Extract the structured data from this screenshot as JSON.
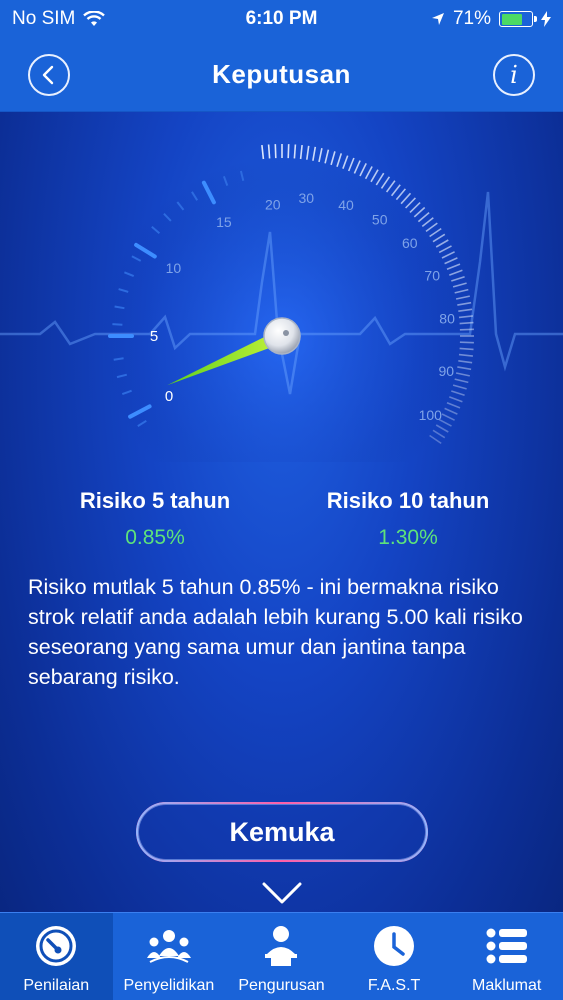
{
  "status_bar": {
    "carrier": "No SIM",
    "time": "6:10 PM",
    "battery": "71%",
    "battery_level": 0.71
  },
  "nav": {
    "title": "Keputusan",
    "back_icon": "chevron-left-icon",
    "info_icon": "info-icon",
    "info_glyph": "i"
  },
  "gauge": {
    "labels": [
      "0",
      "5",
      "10",
      "15",
      "20",
      "30",
      "40",
      "50",
      "60",
      "70",
      "80",
      "90",
      "100"
    ],
    "needle_value": 0.85
  },
  "risk": {
    "five": {
      "label": "Risiko 5 tahun",
      "value": "0.85%"
    },
    "ten": {
      "label": "Risiko 10 tahun",
      "value": "1.30%"
    }
  },
  "description": "Risiko mutlak 5 tahun  0.85% - ini bermakna risiko strok relatif anda adalah lebih kurang 5.00 kali risiko seseorang yang sama umur dan jantina tanpa sebarang risiko.",
  "cta": {
    "label": "Kemuka"
  },
  "tabs": [
    {
      "label": "Penilaian",
      "icon": "gauge-icon",
      "active": true
    },
    {
      "label": "Penyelidikan",
      "icon": "people-icon",
      "active": false
    },
    {
      "label": "Pengurusan",
      "icon": "doctor-icon",
      "active": false
    },
    {
      "label": "F.A.S.T",
      "icon": "clock-icon",
      "active": false
    },
    {
      "label": "Maklumat",
      "icon": "list-icon",
      "active": false
    }
  ],
  "colors": {
    "accent": "#1a63d8",
    "value_green": "#5ee37a",
    "needle": "#9be82a",
    "cta_border": "#ff6fae"
  }
}
